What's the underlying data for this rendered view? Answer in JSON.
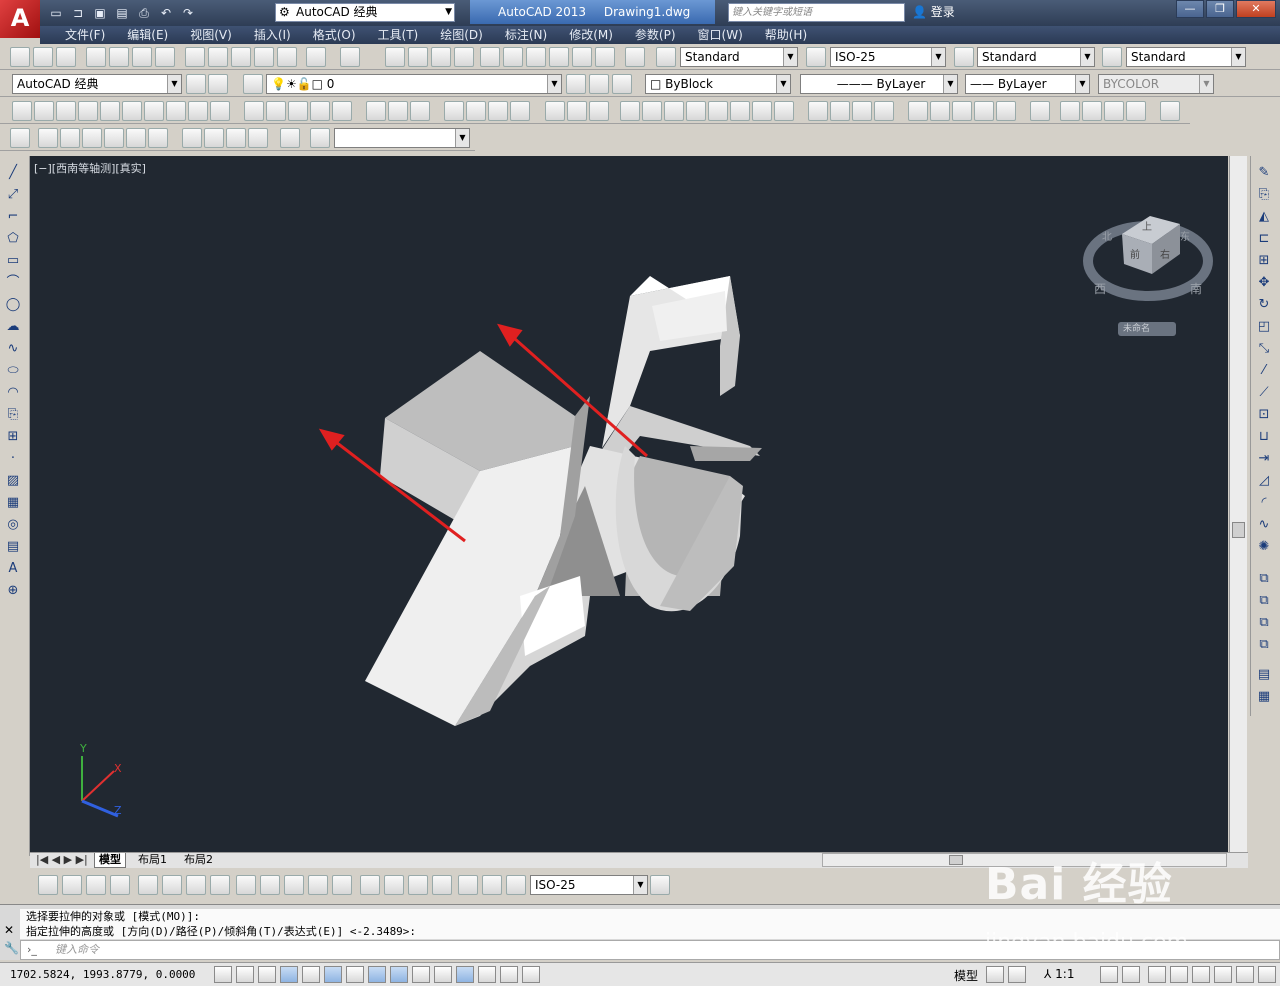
{
  "app": {
    "logo": "A",
    "workspace": "AutoCAD 经典",
    "title_app": "AutoCAD 2013",
    "title_doc": "Drawing1.dwg",
    "search_placeholder": "键入关键字或短语",
    "login": "登录"
  },
  "menu": [
    "文件(F)",
    "编辑(E)",
    "视图(V)",
    "插入(I)",
    "格式(O)",
    "工具(T)",
    "绘图(D)",
    "标注(N)",
    "修改(M)",
    "参数(P)",
    "窗口(W)",
    "帮助(H)"
  ],
  "styles": {
    "text_style": "Standard",
    "dim_style": "ISO-25",
    "table_style": "Standard",
    "mleader_style": "Standard"
  },
  "layers": {
    "workspace": "AutoCAD 经典",
    "layer": "0",
    "color": "ByBlock",
    "linetype": "ByLayer",
    "lineweight": "ByLayer",
    "plotstyle": "BYCOLOR"
  },
  "viewport": {
    "label": "[−][西南等轴测][真实]",
    "viewcube_top": "上",
    "viewcube_front": "前",
    "viewcube_right": "右",
    "compass_n": "北",
    "compass_w": "西",
    "compass_s": "南",
    "compass_e": "东",
    "wcs_label": "未命名"
  },
  "ucs": {
    "x": "X",
    "y": "Y",
    "z": "Z"
  },
  "tabs": [
    "模型",
    "布局1",
    "布局2"
  ],
  "dim_style_combo": "ISO-25",
  "command": {
    "line1": "选择要拉伸的对象或 [模式(MO)]:",
    "line2": "指定拉伸的高度或 [方向(D)/路径(P)/倾斜角(T)/表达式(E)] <-2.3489>:",
    "placeholder": "键入命令"
  },
  "status": {
    "coords": "1702.5824, 1993.8779, 0.0000",
    "model": "模型",
    "scale": "1:1"
  },
  "watermark": {
    "brand": "Bai 经验",
    "url": "jingyan.baidu.com"
  },
  "colors": {
    "accent": "#3a6ab0",
    "viewport_bg": "#212831",
    "arrow": "#e02020"
  }
}
